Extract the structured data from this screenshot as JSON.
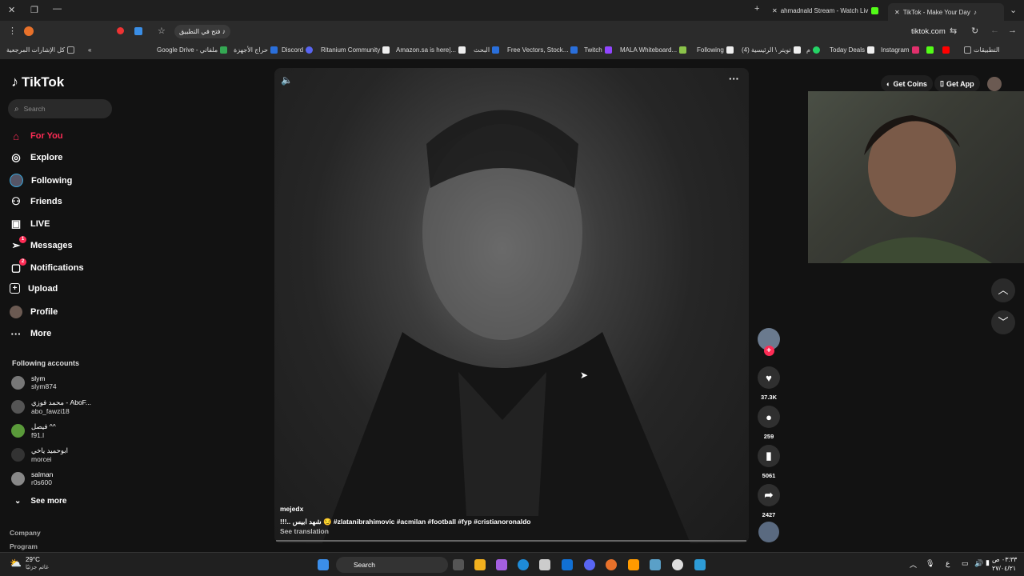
{
  "browser": {
    "tabs": [
      {
        "label": "ahmadnald Stream - Watch Liv"
      },
      {
        "label": "TikTok - Make Your Day"
      }
    ],
    "address": "tiktok.com",
    "open_in_app": "فتح في التطبيق",
    "bookmarks": [
      "كل الإشارات المرجعية",
      "Google Drive - ملفاتي",
      "حراج الأجهزة",
      "Discord",
      "Ritanium Community",
      "Amazon.sa is here|...",
      "البحث",
      "Free Vectors, Stock...",
      "Twitch",
      "MALA Whiteboard...",
      "Following",
      "(4) تويتر \\ الرئيسية",
      "م",
      "Today Deals",
      "Instagram",
      "التطبيقات"
    ]
  },
  "tiktok": {
    "logo": "TikTok",
    "search_placeholder": "Search",
    "nav": [
      {
        "label": "For You",
        "icon": "home-icon",
        "active": true
      },
      {
        "label": "Explore",
        "icon": "compass-icon"
      },
      {
        "label": "Following",
        "icon": "following-icon"
      },
      {
        "label": "Friends",
        "icon": "friends-icon"
      },
      {
        "label": "LIVE",
        "icon": "live-icon"
      },
      {
        "label": "Messages",
        "icon": "messages-icon",
        "badge": "1"
      },
      {
        "label": "Notifications",
        "icon": "bell-icon",
        "badge": "2"
      },
      {
        "label": "Upload",
        "icon": "plus-square-icon"
      },
      {
        "label": "Profile",
        "icon": "avatar"
      },
      {
        "label": "More",
        "icon": "ellipsis-icon"
      }
    ],
    "following_title": "Following accounts",
    "accounts": [
      {
        "name": "slym",
        "user": "slym874"
      },
      {
        "name": "محمد فوزي - AboF...",
        "user": "abo_fawzi18"
      },
      {
        "name": "فيصل ^^",
        "user": "f91.l"
      },
      {
        "name": "ابوحميد ياخي",
        "user": "morcei"
      },
      {
        "name": "salman",
        "user": "r0s600"
      }
    ],
    "see_more": "See more",
    "footer": [
      "Company",
      "Program"
    ],
    "get_coins": "Get Coins",
    "get_app": "Get App",
    "video": {
      "author": "mejedx",
      "caption": "!!!.. شهد ابيس 😏 #zlatanibrahimovic #acmilan #football #fyp #cristianoronaldo",
      "see_translation": "See translation"
    },
    "actions": {
      "likes": "37.3K",
      "comments": "259",
      "saves": "5061",
      "shares": "2427"
    }
  },
  "taskbar": {
    "weather_temp": "29°C",
    "weather_label": "غائم جزئيًا",
    "search": "Search",
    "time": "٠٣:٣٣ ص",
    "date": "٢٧/٠٤/٢١",
    "lang": "ع"
  },
  "colors": {
    "accent": "#fe2c55",
    "bg": "#121212"
  }
}
